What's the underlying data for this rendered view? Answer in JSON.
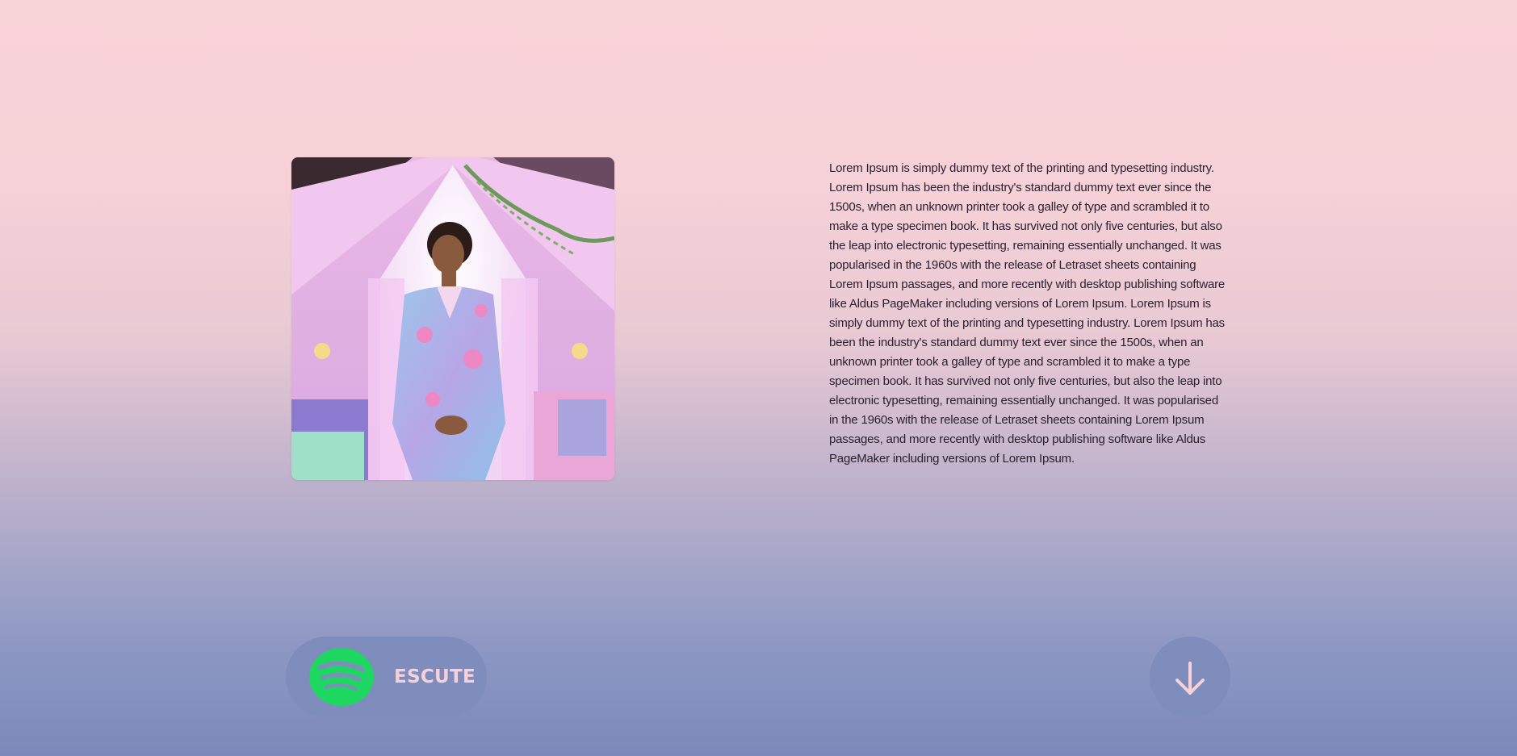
{
  "hero": {
    "image_alt": "Portrait of a young man in a pastel floral suit standing in a pink attic bedroom",
    "body_text": "Lorem Ipsum is simply dummy text of the printing and typesetting industry. Lorem Ipsum has been the industry's standard dummy text ever since the 1500s, when an unknown printer took a galley of type and scrambled it to make a type specimen book. It has survived not only five centuries, but also the leap into electronic typesetting, remaining essentially unchanged. It was popularised in the 1960s with the release of Letraset sheets containing Lorem Ipsum passages, and more recently with desktop publishing software like Aldus PageMaker including versions of Lorem Ipsum. Lorem Ipsum is simply dummy text of the printing and typesetting industry. Lorem Ipsum has been the industry's standard dummy text ever since the 1500s, when an unknown printer took a galley of type and scrambled it to make a type specimen book. It has survived not only five centuries, but also the leap into electronic typesetting, remaining essentially unchanged. It was popularised in the 1960s with the release of Letraset sheets containing Lorem Ipsum passages, and more recently with desktop publishing software like Aldus PageMaker including versions of Lorem Ipsum."
  },
  "actions": {
    "listen_label": "ESCUTE",
    "listen_icon": "spotify-icon",
    "scroll_icon": "arrow-down-icon"
  },
  "colors": {
    "background_top": "#f8d3d8",
    "background_bottom": "#7b8aba",
    "button_bg": "#7f8dbd",
    "spotify_green": "#1ed760",
    "button_text": "#f6d1d8",
    "body_text": "#2a2030"
  }
}
